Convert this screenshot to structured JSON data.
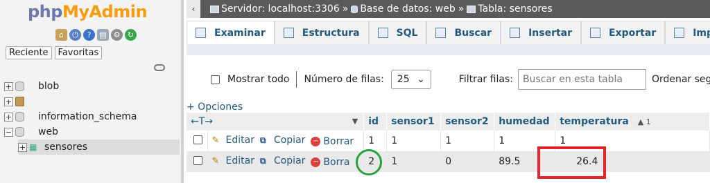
{
  "nav": {
    "logo_php": "php",
    "logo_myadmin": "MyAdmin",
    "tabs": [
      "Reciente",
      "Favoritas"
    ],
    "tree": [
      {
        "expander": "+",
        "label": "blob"
      },
      {
        "expander": "+",
        "label": ""
      },
      {
        "expander": "+",
        "label": "information_schema"
      },
      {
        "expander": "−",
        "label": "web"
      },
      {
        "expander": "+",
        "label": "sensores"
      }
    ]
  },
  "breadcrumb": {
    "back": "‹",
    "server": "Servidor: localhost:3306",
    "database": "Base de datos: web",
    "table": "Tabla: sensores",
    "separator": "»"
  },
  "tabs": [
    "Examinar",
    "Estructura",
    "SQL",
    "Buscar",
    "Insertar",
    "Exportar",
    "Importar"
  ],
  "controls": {
    "show_all": "Mostrar todo",
    "rows_label": "Número de filas:",
    "rows_value": "25",
    "filter_label": "Filtrar filas:",
    "filter_placeholder": "Buscar en esta tabla",
    "sort_label": "Ordenar según"
  },
  "options_link": "+ Opciones",
  "table": {
    "columns": [
      "id",
      "sensor1",
      "sensor2",
      "humedad",
      "temperatura"
    ],
    "sort_indicator": "▲ 1",
    "arrows": "←T→",
    "actions": {
      "edit": "Editar",
      "copy": "Copiar",
      "delete": "Borrar"
    },
    "rows": [
      {
        "id": "1",
        "sensor1": "1",
        "sensor2": "1",
        "humedad": "1",
        "temperatura": "1",
        "delete_label": "Borrar"
      },
      {
        "id": "2",
        "sensor1": "1",
        "sensor2": "0",
        "humedad": "89.5",
        "temperatura": "26.4",
        "delete_label": "Borra"
      }
    ]
  },
  "annotations": {
    "circle_color": "#27a13b",
    "box_color": "#e3262b"
  }
}
